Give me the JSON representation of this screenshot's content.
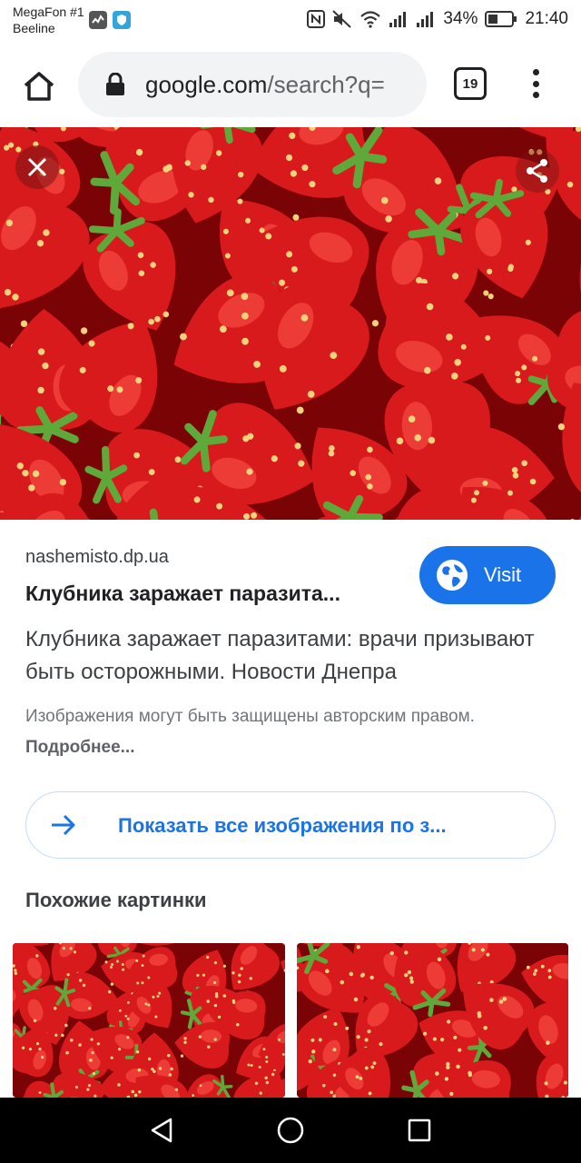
{
  "status_bar": {
    "carrier_line1": "MegaFon #1",
    "carrier_line2": "Beeline",
    "battery_percent": "34%",
    "time": "21:40",
    "icons": [
      "activity-icon",
      "shield-app-icon",
      "nfc-icon",
      "mute-icon",
      "wifi-icon",
      "signal-icon",
      "signal-icon",
      "battery-icon"
    ]
  },
  "browser": {
    "url_host": "google.com",
    "url_path": "/search?q=",
    "tab_count": "19",
    "icons": [
      "home-icon",
      "lock-icon",
      "tabs-icon",
      "more-vert-icon"
    ]
  },
  "viewer": {
    "icons": [
      "close-icon",
      "share-icon"
    ],
    "source_domain": "nashemisto.dp.ua",
    "title": "Клубника заражает паразита...",
    "visit_label": "Visit",
    "description": "Клубника заражает паразитами: врачи призывают быть осторожными. Новости Днепра",
    "copyright_text": "Изображения могут быть защищены авторским правом.",
    "copyright_link": "Подробнее...",
    "show_all_label": "Показать все изображения по з...",
    "similar_heading": "Похожие картинки"
  },
  "colors": {
    "accent": "#1a73e8",
    "strawberry_red": "#d81a1d",
    "leaf_green": "#5fa83a"
  },
  "nav_bar": {
    "icons": [
      "back-triangle-icon",
      "home-circle-icon",
      "recents-square-icon"
    ]
  }
}
